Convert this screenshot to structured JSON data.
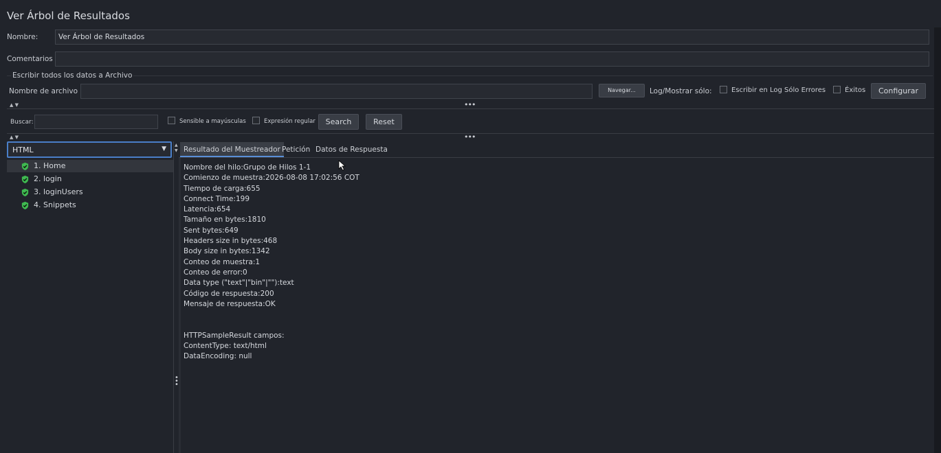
{
  "window": {
    "title": "Ver Árbol de Resultados"
  },
  "form": {
    "name_label": "Nombre:",
    "name_value": "Ver Árbol de Resultados",
    "comments_label": "Comentarios",
    "comments_value": ""
  },
  "file_section": {
    "legend": "Escribir todos los datos a Archivo",
    "filename_label": "Nombre de archivo",
    "filename_value": "",
    "browse_label": "Navegar...",
    "log_label": "Log/Mostrar sólo:",
    "errors_only_label": "Escribir en Log Sólo Errores",
    "success_label": "Éxitos",
    "configure_label": "Configurar"
  },
  "search": {
    "label": "Buscar:",
    "value": "",
    "case_label": "Sensible a mayúsculas",
    "regex_label": "Expresión regular",
    "search_button": "Search",
    "reset_button": "Reset"
  },
  "renderer": {
    "selected": "HTML"
  },
  "tree": {
    "items": [
      {
        "label": "1. Home",
        "selected": true
      },
      {
        "label": "2. login",
        "selected": false
      },
      {
        "label": "3. loginUsers",
        "selected": false
      },
      {
        "label": "4. Snippets",
        "selected": false
      }
    ]
  },
  "tabs": [
    {
      "label": "Resultado del Muestreador",
      "selected": true
    },
    {
      "label": "Petición",
      "selected": false
    },
    {
      "label": "Datos de Respuesta",
      "selected": false
    }
  ],
  "result_lines": [
    "Nombre del hilo:Grupo de Hilos 1-1",
    "Comienzo de muestra:2026-08-08 17:02:56 COT",
    "Tiempo de carga:655",
    "Connect Time:199",
    "Latencia:654",
    "Tamaño en bytes:1810",
    "Sent bytes:649",
    "Headers size in bytes:468",
    "Body size in bytes:1342",
    "Conteo de muestra:1",
    "Conteo de error:0",
    "Data type (\"text\"|\"bin\"|\"\"):text",
    "Código de respuesta:200",
    "Mensaje de respuesta:OK",
    "",
    "",
    "HTTPSampleResult campos:",
    "ContentType: text/html",
    "DataEncoding: null"
  ],
  "colors": {
    "background": "#21242b",
    "accent": "#5a8fd8",
    "success_icon": "#3fb950"
  }
}
